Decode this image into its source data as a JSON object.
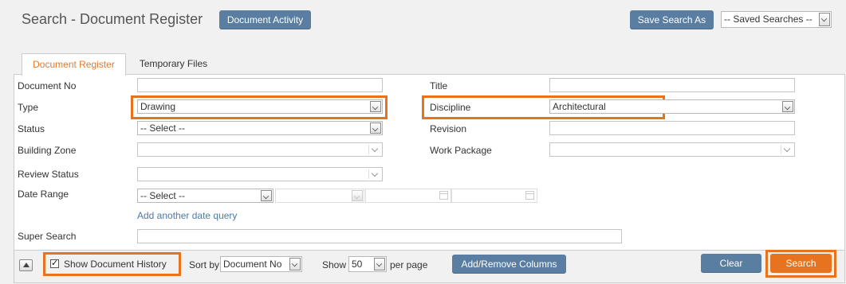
{
  "header": {
    "title": "Search - Document Register",
    "document_activity_label": "Document Activity",
    "save_search_label": "Save Search As",
    "saved_searches_value": "-- Saved Searches --"
  },
  "tabs": [
    {
      "label": "Document Register",
      "active": true
    },
    {
      "label": "Temporary Files",
      "active": false
    }
  ],
  "form": {
    "document_no": {
      "label": "Document No",
      "value": ""
    },
    "title": {
      "label": "Title",
      "value": ""
    },
    "type": {
      "label": "Type",
      "value": "Drawing"
    },
    "discipline": {
      "label": "Discipline",
      "value": "Architectural"
    },
    "status": {
      "label": "Status",
      "value": "-- Select --"
    },
    "revision": {
      "label": "Revision",
      "value": ""
    },
    "building_zone": {
      "label": "Building Zone",
      "value": ""
    },
    "work_package": {
      "label": "Work Package",
      "value": ""
    },
    "review_status": {
      "label": "Review Status",
      "value": ""
    },
    "date_range": {
      "label": "Date Range",
      "value": "-- Select --"
    },
    "add_date_query": "Add another date query",
    "super_search": {
      "label": "Super Search",
      "value": ""
    }
  },
  "footer": {
    "show_history_label": "Show Document History",
    "show_history_checked": true,
    "sort_by_label": "Sort by",
    "sort_by_value": "Document No",
    "show_label": "Show",
    "show_value": "50",
    "per_page_label": "per page",
    "add_remove_columns_label": "Add/Remove Columns",
    "clear_label": "Clear",
    "search_label": "Search"
  },
  "colors": {
    "accent": "#e8731e",
    "button": "#5a7ea2"
  }
}
